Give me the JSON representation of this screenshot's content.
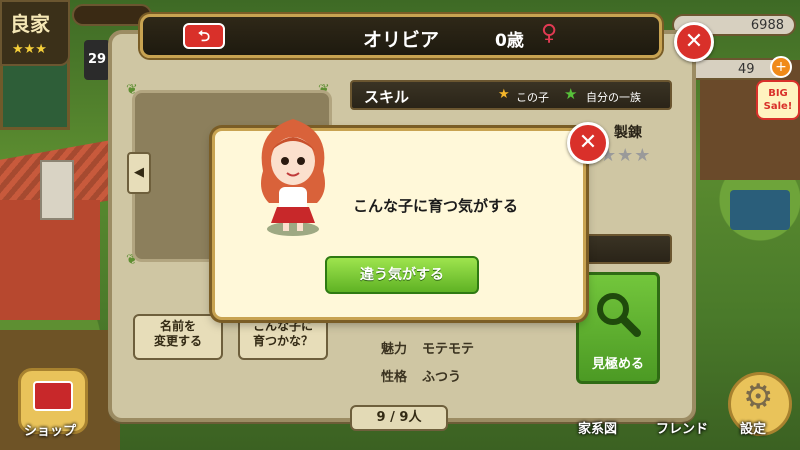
{
  "hud": {
    "rank_label": "良家",
    "coins_value": "6988",
    "gems_value": "49",
    "level_value": "29",
    "big_sale_label": "BIG Sale!"
  },
  "title": {
    "name": "オリビア",
    "age": "0歳",
    "sex_symbol": "♀",
    "back_symbol": "⮌"
  },
  "skill": {
    "header": "スキル",
    "legend_this_child": "この子",
    "legend_family": "自分の一族",
    "column_label": "製錬",
    "stars_filled": 0,
    "stars_total": 3
  },
  "buttons": {
    "rename": "名前を\n変更する",
    "grow_check": "こんな子に\n育つかな？",
    "inspect": "見極める"
  },
  "stats": [
    {
      "label": "魅力",
      "value": "モテモテ"
    },
    {
      "label": "性格",
      "value": "ふつう"
    }
  ],
  "pager": {
    "current": "9",
    "total_text": "/ 9人"
  },
  "modal": {
    "message": "こんな子に育つ気がする",
    "button": "違う気がする"
  },
  "bottom_nav": {
    "shop": "ショップ",
    "family_tree": "家系図",
    "friends": "フレンド",
    "settings": "設定"
  },
  "colors": {
    "accent_red": "#d9302a",
    "accent_green": "#5fb224",
    "panel_bg": "#cfc6a3",
    "modal_bg": "#fff8d9"
  }
}
